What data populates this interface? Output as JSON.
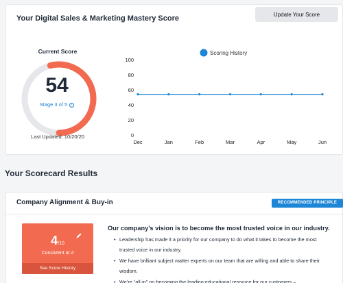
{
  "header": {
    "title": "Your Digital Sales & Marketing Mastery Score",
    "update_button": "Update Your Score"
  },
  "current_score": {
    "label": "Current Score",
    "value": "54",
    "score_fraction": 0.54,
    "stage": "Stage 3 of 5",
    "last_updated": "Last Updated: 10/20/20",
    "colors": {
      "progress": "#f26a50",
      "track": "#e5e7eb"
    }
  },
  "chart_data": {
    "type": "line",
    "x": [
      "Dec",
      "Jan",
      "Feb",
      "Mar",
      "Apr",
      "May",
      "Jun"
    ],
    "series": [
      {
        "name": "Scoring History",
        "values": [
          54,
          54,
          54,
          54,
          54,
          54,
          54
        ],
        "color": "#1d86d6"
      }
    ],
    "ylim": [
      0,
      100
    ],
    "yticks": [
      0,
      20,
      40,
      60,
      80,
      100
    ],
    "grid": false,
    "legend": "top-center"
  },
  "scorecard": {
    "section_title": "Your Scorecard Results",
    "item_title": "Company Alignment & Buy-in",
    "badge": "RECOMMENDED PRINCIPLE",
    "score": "4",
    "score_max": "/10",
    "consistency": "Consistent at 4",
    "history_link": "See Score History",
    "vision": "Our company’s vision is to become the most trusted voice in our industry.",
    "bullets": [
      "Leadership has made it a priority for our company to do what it takes to become the most trusted voice in our industry.",
      "We have brilliant subject matter experts on our team that are willing and able to share their wisdom.",
      "We’re “all-in” on becoming the leading educational resource for our customers –"
    ]
  }
}
